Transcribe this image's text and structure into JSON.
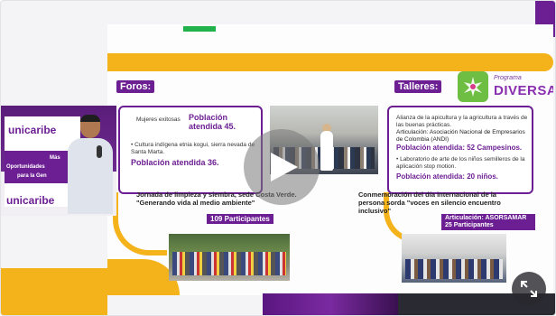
{
  "speaker": {
    "logo_top": "unicaribe",
    "logo_bottom": "unicaribe",
    "banner_line1": "Más",
    "banner_line2": "Oportunidades",
    "banner_line3": "para la Gen"
  },
  "slide": {
    "program_small": "Programa",
    "program_big": "DIVERSA",
    "foros": {
      "tag": "Foros:",
      "item1": "Mujeres exitosas",
      "item1_bold": "Población atendida 45.",
      "item2": "• Cultura indígena etnia kogui, sierra nevada de Santa Marta.",
      "item2_bold": "Población atendida 36."
    },
    "talleres": {
      "tag": "Talleres:",
      "item1": "Alianza de la apicultura y la agricultura a través de las buenas prácticas.",
      "item1_art": "Articulación: Asociación Nacional de Empresarios de Colombia (ANDI)",
      "item1_bold": "Población atendida: 52 Campesinos.",
      "item2": "• Laboratorio de arte de los niños semilleros de la aplicación stop motion.",
      "item2_bold": "Población atendida: 20 niños."
    },
    "jornada": {
      "caption": "Jornada de limpieza y siembra, sede Costa Verde. \"Generando vida al medio ambiente\"",
      "pill": "109 Participantes"
    },
    "conmemoracion": {
      "caption": "Conmemoración del día internacional de la persona sorda \"voces en silencio encuentro inclusivo\"",
      "pill": "Articulación: ASORSAMAR 25 Participantes"
    }
  },
  "controls": {
    "play_icon": "play-icon",
    "expand_icon": "expand-icon"
  },
  "colors": {
    "purple": "#6c1f93",
    "yellow": "#f4b31b",
    "green": "#21b24b"
  }
}
